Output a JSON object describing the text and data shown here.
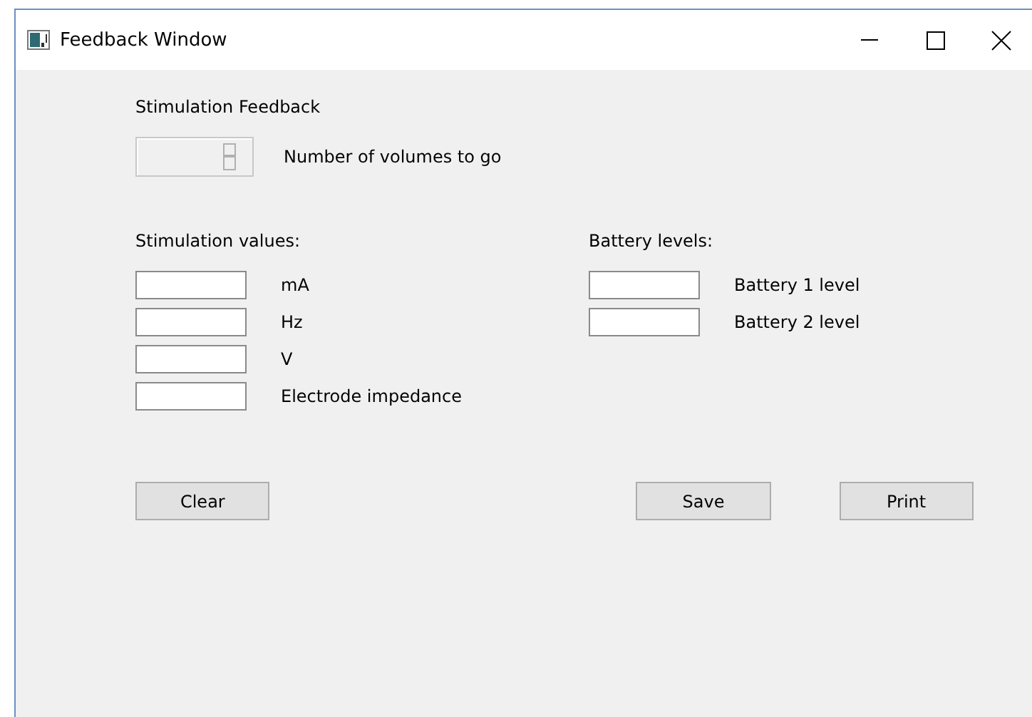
{
  "window": {
    "title": "Feedback Window"
  },
  "heading": "Stimulation Feedback",
  "counter": {
    "label": "Number of volumes to go"
  },
  "stimulation": {
    "title": "Stimulation values:",
    "fields": [
      {
        "label": "mA"
      },
      {
        "label": "Hz"
      },
      {
        "label": "V"
      },
      {
        "label": "Electrode impedance"
      }
    ]
  },
  "battery": {
    "title": "Battery levels:",
    "fields": [
      {
        "label": "Battery 1 level"
      },
      {
        "label": "Battery 2 level"
      }
    ]
  },
  "buttons": [
    {
      "label": "Clear",
      "kind": "left"
    },
    {
      "label": "Save",
      "kind": "right"
    },
    {
      "label": "Print",
      "kind": "right"
    }
  ]
}
